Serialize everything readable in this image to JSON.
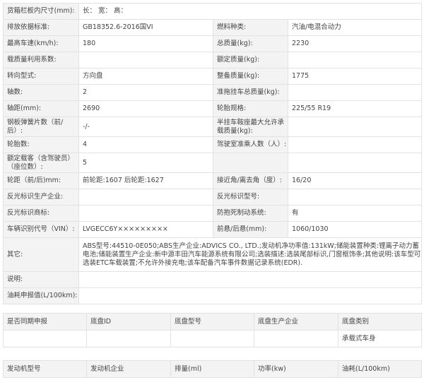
{
  "main_table": {
    "rows": [
      {
        "cells": [
          {
            "label": "货箱栏板内尺寸(mm):",
            "value": "长：  宽：  高："
          }
        ]
      },
      {
        "cells": [
          {
            "label": "排放依据标准:",
            "value": "GB18352.6-2016国VI"
          },
          {
            "label": "燃料种类:",
            "value": "汽油/电混合动力"
          }
        ]
      },
      {
        "cells": [
          {
            "label": "最高车速(km/h):",
            "value": "180"
          },
          {
            "label": "总质量(kg):",
            "value": "2230"
          }
        ]
      },
      {
        "cells": [
          {
            "label": "载质量利用系数:",
            "value": ""
          },
          {
            "label": "额定质量(kg):",
            "value": ""
          }
        ]
      },
      {
        "cells": [
          {
            "label": "转向型式:",
            "value": "方向盘"
          },
          {
            "label": "整备质量(kg):",
            "value": "1775"
          }
        ]
      },
      {
        "cells": [
          {
            "label": "轴数:",
            "value": "2"
          },
          {
            "label": "准拖挂车总质量(kg):",
            "value": ""
          }
        ]
      },
      {
        "cells": [
          {
            "label": "轴距(mm):",
            "value": "2690"
          },
          {
            "label": "轮胎规格:",
            "value": "225/55 R19"
          }
        ]
      },
      {
        "cells": [
          {
            "label": "钢板弹簧片数（前/后）:",
            "value": "-/-"
          },
          {
            "label": "半挂车鞍座最大允许承载质量(kg):",
            "value": ""
          }
        ]
      },
      {
        "cells": [
          {
            "label": "轮胎数:",
            "value": "4"
          },
          {
            "label": "驾驶室准乘人数（人）:",
            "value": ""
          }
        ]
      },
      {
        "cells": [
          {
            "label": "额定载客（含驾驶员）（座位数）:",
            "value": "5"
          },
          {
            "label": "",
            "value": ""
          }
        ]
      },
      {
        "cells": [
          {
            "label": "轮距（前/后)mm:",
            "value": "前轮距:1607 后轮距:1627"
          },
          {
            "label": "接近角/离去角（度）:",
            "value": "16/20"
          }
        ]
      },
      {
        "cells": [
          {
            "label": "反光标识生产企业:",
            "value": ""
          },
          {
            "label": "反光标识型号:",
            "value": ""
          }
        ]
      },
      {
        "cells": [
          {
            "label": "反光标识商标:",
            "value": ""
          },
          {
            "label": "防抱死制动系统:",
            "value": "有"
          }
        ]
      },
      {
        "cells": [
          {
            "label": "车辆识别代号（VIN）:",
            "value": "LVGECC6Y×××××××××"
          },
          {
            "label": "前悬/后悬(mm):",
            "value": "1060/1030"
          }
        ]
      },
      {
        "cells": [
          {
            "label": "其它:",
            "value": "ABS型号:44510-0E050;ABS生产企业:ADVICS CO., LTD.;发动机净功率值:131kW;储能装置种类:锂离子动力蓄电池;储能装置生产企业:新中源丰田汽车能源系统有限公司;选装描述:选装尾部标识,门窗框饰条;其他说明:该车型可选装ETC车载装置;不允许外接充电;该车配备汽车事件数据记录系统(EDR)."
          }
        ]
      },
      {
        "cells": [
          {
            "label": "说明:",
            "value": ""
          }
        ]
      },
      {
        "cells": [
          {
            "label": "油耗申报值(L/100km):",
            "value": ""
          }
        ]
      }
    ]
  },
  "chassis_table": {
    "headers": [
      "是否同期申报",
      "底盘ID",
      "底盘型号",
      "底盘生产企业",
      "底盘类别"
    ],
    "rows": [
      [
        "",
        "",
        "",
        "",
        "承载式车身"
      ]
    ]
  },
  "engine_table": {
    "headers": [
      "发动机型号",
      "发动机企业",
      "排量(ml)",
      "功率(kw)",
      "油耗(L/100km)"
    ]
  }
}
